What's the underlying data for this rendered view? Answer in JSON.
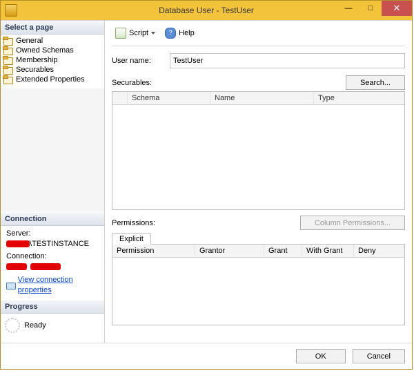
{
  "window": {
    "title": "Database User - TestUser",
    "min": "—",
    "max": "□",
    "close": "✕"
  },
  "sidebar": {
    "select_page_header": "Select a page",
    "pages": [
      {
        "label": "General"
      },
      {
        "label": "Owned Schemas"
      },
      {
        "label": "Membership"
      },
      {
        "label": "Securables"
      },
      {
        "label": "Extended Properties"
      }
    ],
    "connection_header": "Connection",
    "connection": {
      "server_label": "Server:",
      "server_value_suffix": "\\TESTINSTANCE",
      "connection_label": "Connection:",
      "view_props_link": "View connection properties"
    },
    "progress_header": "Progress",
    "progress_status": "Ready"
  },
  "toolbar": {
    "script_label": "Script",
    "help_label": "Help"
  },
  "form": {
    "user_name_label": "User name:",
    "user_name_value": "TestUser",
    "securables_label": "Securables:",
    "search_button": "Search...",
    "securables_columns": [
      "",
      "Schema",
      "Name",
      "Type"
    ],
    "permissions_label": "Permissions:",
    "column_permissions_button": "Column Permissions...",
    "explicit_tab": "Explicit",
    "permissions_columns": [
      "Permission",
      "Grantor",
      "Grant",
      "With Grant",
      "Deny"
    ]
  },
  "footer": {
    "ok": "OK",
    "cancel": "Cancel"
  }
}
